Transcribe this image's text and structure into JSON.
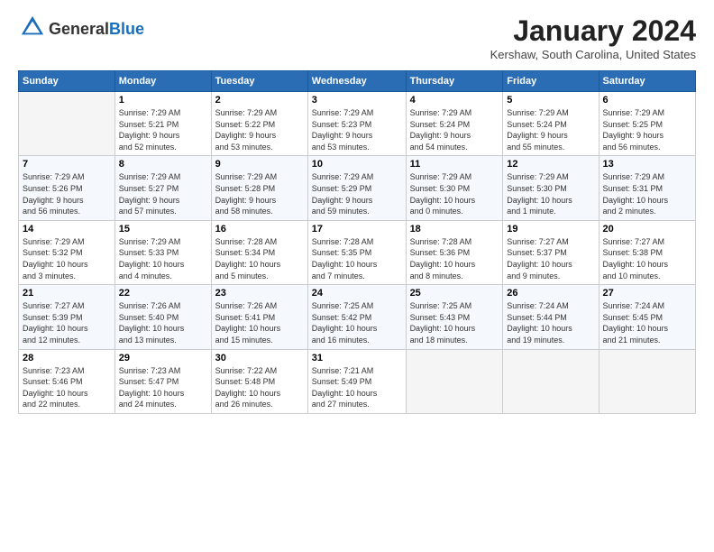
{
  "header": {
    "logo_general": "General",
    "logo_blue": "Blue",
    "month_title": "January 2024",
    "location": "Kershaw, South Carolina, United States"
  },
  "days_of_week": [
    "Sunday",
    "Monday",
    "Tuesday",
    "Wednesday",
    "Thursday",
    "Friday",
    "Saturday"
  ],
  "weeks": [
    [
      {
        "day": "",
        "info": ""
      },
      {
        "day": "1",
        "info": "Sunrise: 7:29 AM\nSunset: 5:21 PM\nDaylight: 9 hours\nand 52 minutes."
      },
      {
        "day": "2",
        "info": "Sunrise: 7:29 AM\nSunset: 5:22 PM\nDaylight: 9 hours\nand 53 minutes."
      },
      {
        "day": "3",
        "info": "Sunrise: 7:29 AM\nSunset: 5:23 PM\nDaylight: 9 hours\nand 53 minutes."
      },
      {
        "day": "4",
        "info": "Sunrise: 7:29 AM\nSunset: 5:24 PM\nDaylight: 9 hours\nand 54 minutes."
      },
      {
        "day": "5",
        "info": "Sunrise: 7:29 AM\nSunset: 5:24 PM\nDaylight: 9 hours\nand 55 minutes."
      },
      {
        "day": "6",
        "info": "Sunrise: 7:29 AM\nSunset: 5:25 PM\nDaylight: 9 hours\nand 56 minutes."
      }
    ],
    [
      {
        "day": "7",
        "info": "Sunrise: 7:29 AM\nSunset: 5:26 PM\nDaylight: 9 hours\nand 56 minutes."
      },
      {
        "day": "8",
        "info": "Sunrise: 7:29 AM\nSunset: 5:27 PM\nDaylight: 9 hours\nand 57 minutes."
      },
      {
        "day": "9",
        "info": "Sunrise: 7:29 AM\nSunset: 5:28 PM\nDaylight: 9 hours\nand 58 minutes."
      },
      {
        "day": "10",
        "info": "Sunrise: 7:29 AM\nSunset: 5:29 PM\nDaylight: 9 hours\nand 59 minutes."
      },
      {
        "day": "11",
        "info": "Sunrise: 7:29 AM\nSunset: 5:30 PM\nDaylight: 10 hours\nand 0 minutes."
      },
      {
        "day": "12",
        "info": "Sunrise: 7:29 AM\nSunset: 5:30 PM\nDaylight: 10 hours\nand 1 minute."
      },
      {
        "day": "13",
        "info": "Sunrise: 7:29 AM\nSunset: 5:31 PM\nDaylight: 10 hours\nand 2 minutes."
      }
    ],
    [
      {
        "day": "14",
        "info": "Sunrise: 7:29 AM\nSunset: 5:32 PM\nDaylight: 10 hours\nand 3 minutes."
      },
      {
        "day": "15",
        "info": "Sunrise: 7:29 AM\nSunset: 5:33 PM\nDaylight: 10 hours\nand 4 minutes."
      },
      {
        "day": "16",
        "info": "Sunrise: 7:28 AM\nSunset: 5:34 PM\nDaylight: 10 hours\nand 5 minutes."
      },
      {
        "day": "17",
        "info": "Sunrise: 7:28 AM\nSunset: 5:35 PM\nDaylight: 10 hours\nand 7 minutes."
      },
      {
        "day": "18",
        "info": "Sunrise: 7:28 AM\nSunset: 5:36 PM\nDaylight: 10 hours\nand 8 minutes."
      },
      {
        "day": "19",
        "info": "Sunrise: 7:27 AM\nSunset: 5:37 PM\nDaylight: 10 hours\nand 9 minutes."
      },
      {
        "day": "20",
        "info": "Sunrise: 7:27 AM\nSunset: 5:38 PM\nDaylight: 10 hours\nand 10 minutes."
      }
    ],
    [
      {
        "day": "21",
        "info": "Sunrise: 7:27 AM\nSunset: 5:39 PM\nDaylight: 10 hours\nand 12 minutes."
      },
      {
        "day": "22",
        "info": "Sunrise: 7:26 AM\nSunset: 5:40 PM\nDaylight: 10 hours\nand 13 minutes."
      },
      {
        "day": "23",
        "info": "Sunrise: 7:26 AM\nSunset: 5:41 PM\nDaylight: 10 hours\nand 15 minutes."
      },
      {
        "day": "24",
        "info": "Sunrise: 7:25 AM\nSunset: 5:42 PM\nDaylight: 10 hours\nand 16 minutes."
      },
      {
        "day": "25",
        "info": "Sunrise: 7:25 AM\nSunset: 5:43 PM\nDaylight: 10 hours\nand 18 minutes."
      },
      {
        "day": "26",
        "info": "Sunrise: 7:24 AM\nSunset: 5:44 PM\nDaylight: 10 hours\nand 19 minutes."
      },
      {
        "day": "27",
        "info": "Sunrise: 7:24 AM\nSunset: 5:45 PM\nDaylight: 10 hours\nand 21 minutes."
      }
    ],
    [
      {
        "day": "28",
        "info": "Sunrise: 7:23 AM\nSunset: 5:46 PM\nDaylight: 10 hours\nand 22 minutes."
      },
      {
        "day": "29",
        "info": "Sunrise: 7:23 AM\nSunset: 5:47 PM\nDaylight: 10 hours\nand 24 minutes."
      },
      {
        "day": "30",
        "info": "Sunrise: 7:22 AM\nSunset: 5:48 PM\nDaylight: 10 hours\nand 26 minutes."
      },
      {
        "day": "31",
        "info": "Sunrise: 7:21 AM\nSunset: 5:49 PM\nDaylight: 10 hours\nand 27 minutes."
      },
      {
        "day": "",
        "info": ""
      },
      {
        "day": "",
        "info": ""
      },
      {
        "day": "",
        "info": ""
      }
    ]
  ]
}
